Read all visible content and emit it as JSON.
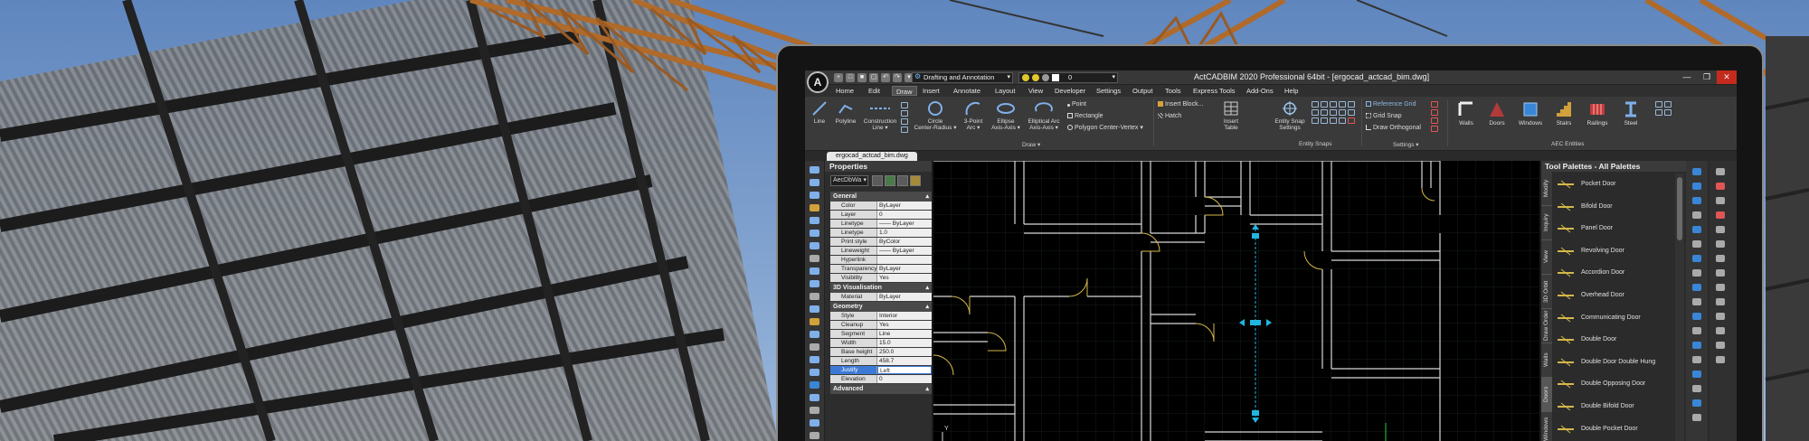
{
  "window": {
    "title": "ActCADBIM 2020 Professional 64bit - [ergocad_actcad_bim.dwg]",
    "logo_letter": "A",
    "workspace": "Drafting and Annotation",
    "layer": "0",
    "buttons": [
      "—",
      "❐",
      "✕"
    ]
  },
  "menu": [
    "Home",
    "Edit",
    "Draw",
    "Insert",
    "Annotate",
    "Layout",
    "View",
    "Developer",
    "Settings",
    "Output",
    "Tools",
    "Express Tools",
    "Add-Ons",
    "Help"
  ],
  "menu_active": "Draw",
  "ribbon": {
    "line": "Line",
    "polyline": "Polyline",
    "construction": "Construction",
    "construction2": "Line ▾",
    "circle": "Circle",
    "circle2": "Center-Radius ▾",
    "arc": "3-Point",
    "arc2": "Arc ▾",
    "ellipse": "Ellipse",
    "ellipse2": "Axis-Axis ▾",
    "ellarc": "Elliptical Arc",
    "ellarc2": "Axis-Axis ▾",
    "point": "Point",
    "rectangle": "Rectangle",
    "polygon": "Polygon Center-Vertex ▾",
    "insert_block": "Insert Block...",
    "hatch": "Hatch",
    "insert_table": "Insert",
    "insert_table2": "Table",
    "entity_snap": "Entity Snap",
    "entity_snap2": "Settings",
    "ref_grid": "Reference Grid",
    "grid_snap": "Grid Snap",
    "draw_ortho": "Draw Orthogonal",
    "walls": "Walls",
    "doors": "Doors",
    "windows": "Windows",
    "stairs": "Stairs",
    "railings": "Railings",
    "steel": "Steel",
    "group_draw": "Draw ▾",
    "group_snaps": "Entity Snaps",
    "group_settings": "Settings ▾",
    "group_aec": "AEC Entities"
  },
  "doc_tab": "ergocad_actcad_bim.dwg",
  "properties": {
    "title": "Properties",
    "selector": "AecDbWa",
    "general_label": "General",
    "general": [
      {
        "k": "Color",
        "v": "ByLayer"
      },
      {
        "k": "Layer",
        "v": "0"
      },
      {
        "k": "Linetype",
        "v": "—— ByLayer"
      },
      {
        "k": "Linetype scale",
        "v": "1.0"
      },
      {
        "k": "Print style",
        "v": "ByColor"
      },
      {
        "k": "Lineweight",
        "v": "—— ByLayer"
      },
      {
        "k": "Hyperlink",
        "v": ""
      },
      {
        "k": "Transparency",
        "v": "ByLayer"
      },
      {
        "k": "Visibility",
        "v": "Yes"
      }
    ],
    "vis_label": "3D Visualisation",
    "vis": [
      {
        "k": "Material",
        "v": "ByLayer"
      }
    ],
    "geo_label": "Geometry",
    "geo": [
      {
        "k": "Style",
        "v": "Interior"
      },
      {
        "k": "Cleanup auto...",
        "v": "Yes"
      },
      {
        "k": "Segment type",
        "v": "Line"
      },
      {
        "k": "Width",
        "v": "15.0"
      },
      {
        "k": "Base height",
        "v": "250.0"
      },
      {
        "k": "Length",
        "v": "458.7"
      },
      {
        "k": "Justify",
        "v": "Left"
      },
      {
        "k": "Elevation",
        "v": "0"
      }
    ],
    "more_label": "Advanced"
  },
  "palette": {
    "title": "Tool Palettes - All Palettes",
    "tabs": [
      "Modify",
      "Inquiry",
      "View",
      "3D Orbit",
      "Draw Order",
      "Walls",
      "Doors",
      "Windows"
    ],
    "active_tab": "Doors",
    "items": [
      "Pocket Door",
      "Bifold Door",
      "Panel Door",
      "Revolving Door",
      "Accordion Door",
      "Overhead Door",
      "Communicating Door",
      "Double Door",
      "Double Door Double Hung",
      "Double Opposing Door",
      "Double Bifold Door",
      "Double Pocket Door"
    ]
  },
  "canvas": {
    "ucs_label": "Y"
  },
  "colors": {
    "accent": "#3d7ad6",
    "wall": "#d8d8d8",
    "door": "#d4b74a",
    "grip": "#21b6e0",
    "close": "#c42b1c"
  }
}
